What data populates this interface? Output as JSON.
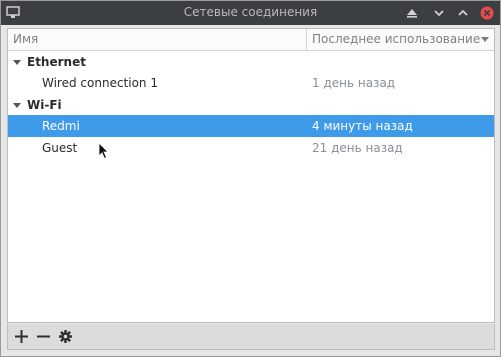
{
  "window": {
    "title": "Сетевые соединения"
  },
  "table": {
    "columns": {
      "name": "Имя",
      "last_used": "Последнее использование"
    },
    "groups": [
      {
        "label": "Ethernet",
        "items": [
          {
            "name": "Wired connection 1",
            "last_used": "1 день назад",
            "selected": false
          }
        ]
      },
      {
        "label": "Wi-Fi",
        "items": [
          {
            "name": "Redmi",
            "last_used": "4 минуты назад",
            "selected": true
          },
          {
            "name": "Guest",
            "last_used": "21 день назад",
            "selected": false
          }
        ]
      }
    ]
  },
  "toolbar": {
    "add_icon": "plus-icon",
    "remove_icon": "minus-icon",
    "settings_icon": "gear-icon"
  },
  "colors": {
    "titlebar": "#3c3f41",
    "selection": "#3d9be9",
    "close_button": "#e84a4a"
  }
}
